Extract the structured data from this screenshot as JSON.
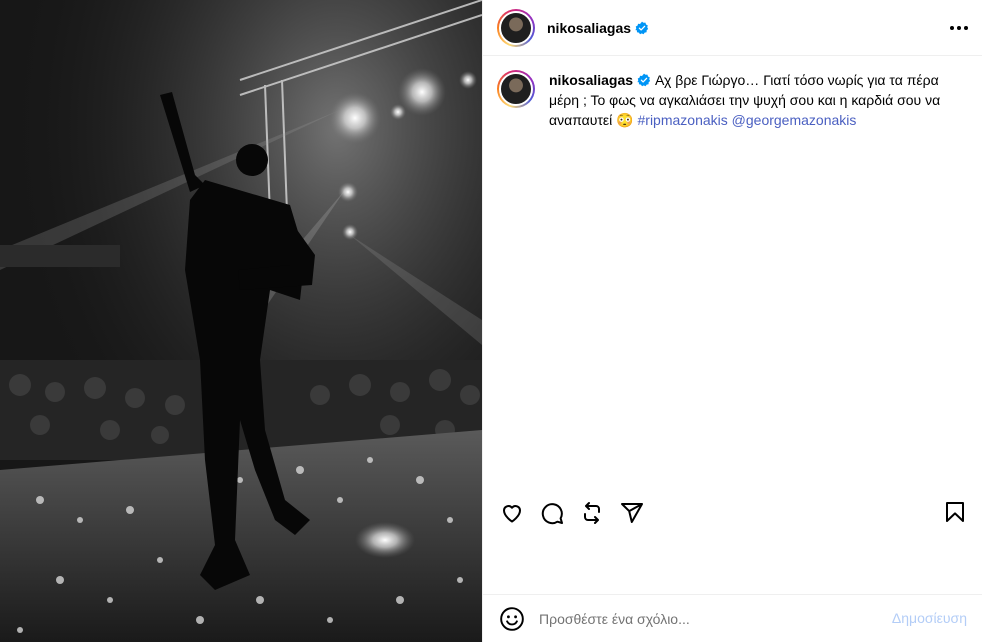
{
  "post": {
    "photo_alt": "",
    "icons": {
      "verified": "verified-badge-icon",
      "more": "more-options-icon",
      "like": "heart-icon",
      "comment": "comment-icon",
      "repost": "repost-icon",
      "share": "share-icon",
      "save": "bookmark-icon",
      "emoji": "emoji-icon"
    },
    "accent_color": "#0095f6"
  },
  "header": {
    "username": "nikosaliagas"
  },
  "caption": {
    "username": "nikosaliagas",
    "text": "Αχ βρε Γιώργο… Γιατί τόσο νωρίς για τα πέρα μέρη ; Το φως να αγκαλιάσει την ψυχή σου και η καρδιά σου να αναπαυτεί",
    "emoji": "😳",
    "hashtag": "#ripmazonakis",
    "mention": "@georgemazonakis"
  },
  "comment": {
    "placeholder": "Προσθέστε ένα σχόλιο...",
    "post_label": "Δημοσίευση"
  }
}
